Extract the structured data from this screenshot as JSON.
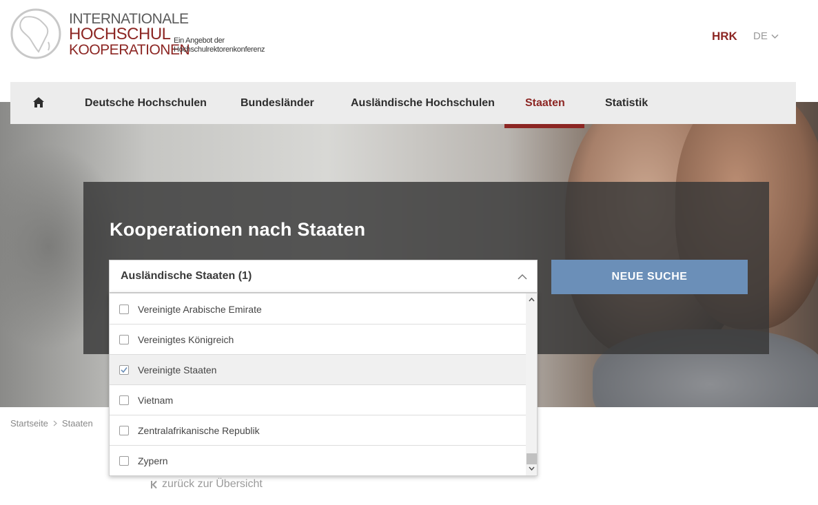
{
  "header": {
    "logo": {
      "line1": "INTERNATIONALE",
      "line2": "HOCHSCHUL",
      "line3": "KOOPERATIONEN",
      "tagline_line1": "Ein Angebot der",
      "tagline_line2": "Hochschulrektorenkonferenz"
    },
    "hrk_link": "HRK",
    "language": {
      "current": "DE",
      "icon": "chevron-down-icon"
    }
  },
  "nav": {
    "home_icon": "home-icon",
    "items": [
      {
        "label": "Deutsche Hochschulen",
        "active": false
      },
      {
        "label": "Bundesländer",
        "active": false
      },
      {
        "label": "Ausländische Hochschulen",
        "active": false
      },
      {
        "label": "Staaten",
        "active": true
      },
      {
        "label": "Statistik",
        "active": false
      }
    ],
    "active_color": "#8c2623"
  },
  "search": {
    "title": "Kooperationen nach Staaten",
    "select_label": "Ausländische Staaten (1)",
    "select_expanded": true,
    "button_label": "NEUE SUCHE",
    "button_color": "#6b8fb8",
    "options": [
      {
        "label": "Vereinigte Arabische Emirate",
        "checked": false
      },
      {
        "label": "Vereinigtes Königreich",
        "checked": false
      },
      {
        "label": "Vereinigte Staaten",
        "checked": true
      },
      {
        "label": "Vietnam",
        "checked": false
      },
      {
        "label": "Zentralafrikanische Republik",
        "checked": false
      },
      {
        "label": "Zypern",
        "checked": false
      }
    ]
  },
  "breadcrumb": {
    "items": [
      "Startseite",
      "Staaten"
    ]
  },
  "back_link": "zurück zur Übersicht"
}
